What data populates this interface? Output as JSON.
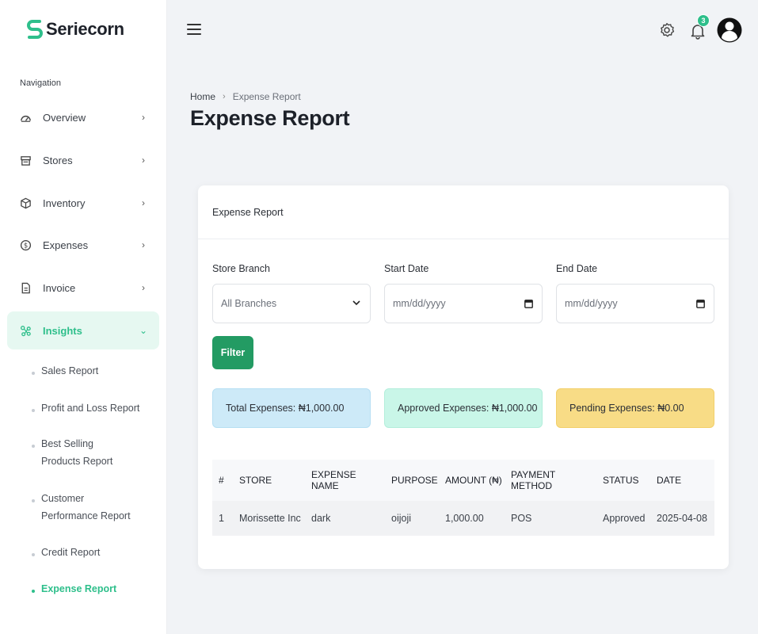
{
  "app": {
    "brand": "Seriecorn",
    "notification_count": "3"
  },
  "sidebar": {
    "heading": "Navigation",
    "items": [
      {
        "label": "Overview",
        "chevron": "›",
        "icon": "dashboard-icon"
      },
      {
        "label": "Stores",
        "chevron": "›",
        "icon": "store-icon"
      },
      {
        "label": "Inventory",
        "chevron": "›",
        "icon": "box-icon"
      },
      {
        "label": "Expenses",
        "chevron": "›",
        "icon": "dollar-icon"
      },
      {
        "label": "Invoice",
        "chevron": "›",
        "icon": "document-icon"
      },
      {
        "label": "Insights",
        "chevron": "⌄",
        "icon": "nodes-icon"
      }
    ],
    "subitems": [
      {
        "label": "Sales Report"
      },
      {
        "label": "Profit and Loss Report"
      },
      {
        "label": "Best Selling Products Report"
      },
      {
        "label": "Customer Performance Report"
      },
      {
        "label": "Credit Report"
      },
      {
        "label": "Expense Report"
      }
    ]
  },
  "breadcrumb": {
    "home": "Home",
    "separator": "›",
    "current": "Expense Report"
  },
  "page": {
    "title": "Expense Report"
  },
  "card": {
    "title": "Expense Report",
    "filters": {
      "store_branch_label": "Store Branch",
      "store_branch_value": "All Branches",
      "start_date_label": "Start Date",
      "start_date_placeholder": "mm/dd/yyyy",
      "end_date_label": "End Date",
      "end_date_placeholder": "mm/dd/yyyy",
      "filter_button": "Filter"
    },
    "stats": {
      "total": "Total Expenses: ₦1,000.00",
      "approved": "Approved Expenses: ₦1,000.00",
      "pending": "Pending Expenses: ₦0.00"
    },
    "table": {
      "headers": [
        "#",
        "STORE",
        "EXPENSE NAME",
        "PURPOSE",
        "AMOUNT (₦)",
        "PAYMENT METHOD",
        "STATUS",
        "DATE"
      ],
      "rows": [
        [
          "1",
          "Morissette Inc",
          "dark",
          "oijoji",
          "1,000.00",
          "POS",
          "Approved",
          "2025-04-08"
        ]
      ]
    }
  },
  "colors": {
    "accent": "#2ebf8b",
    "button": "#239b63",
    "total_bg": "#cdeaf8",
    "approved_bg": "#c9f6e8",
    "pending_bg": "#f8dc86"
  }
}
